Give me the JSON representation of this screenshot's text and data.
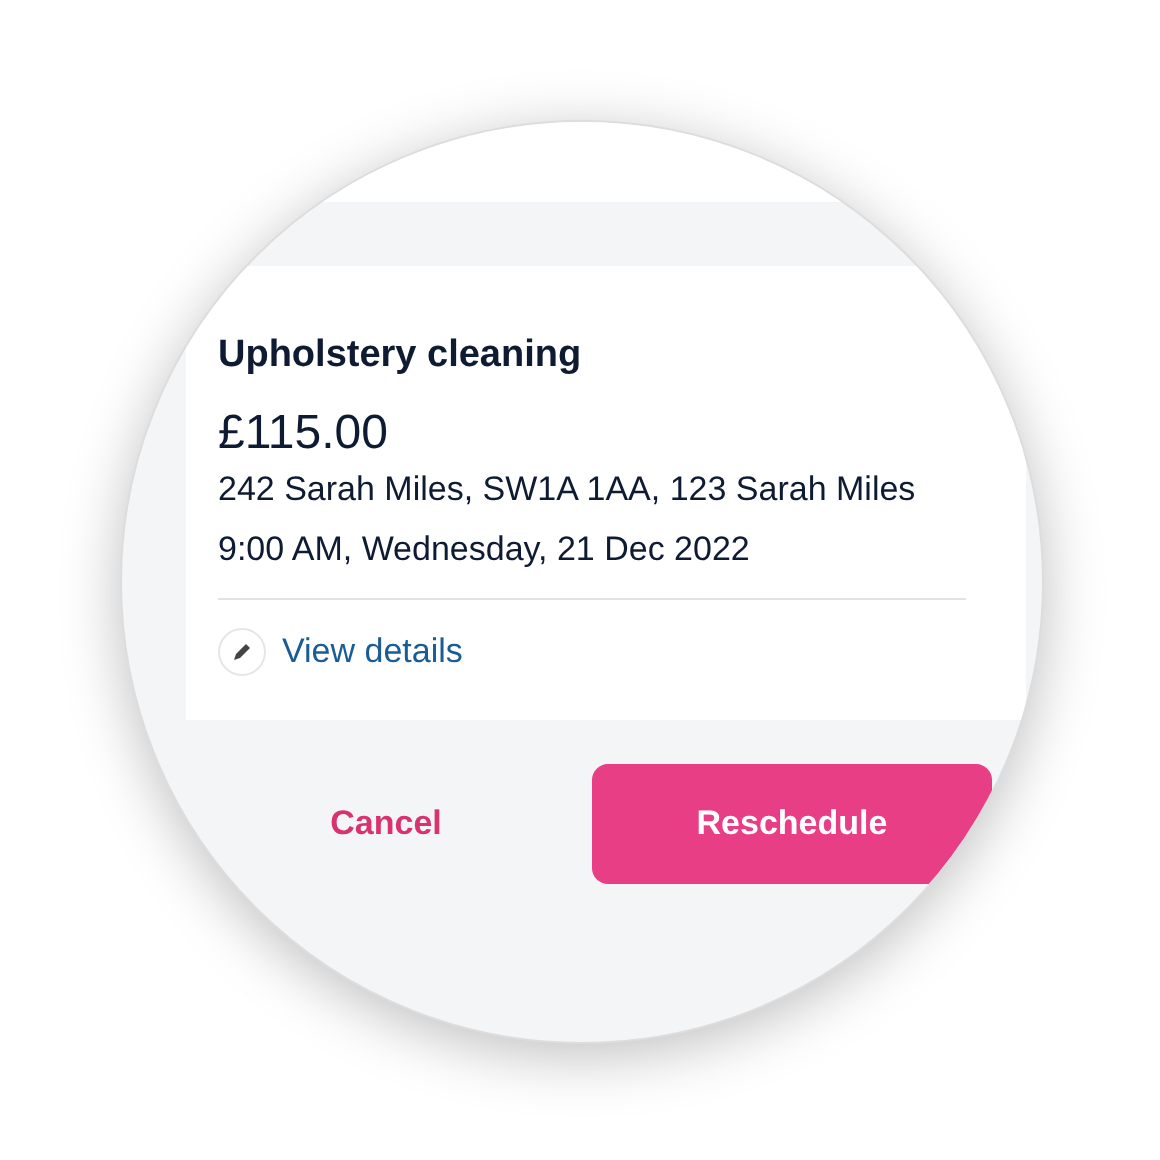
{
  "booking": {
    "service": "Upholstery cleaning",
    "price": "£115.00",
    "address": "242 Sarah Miles, SW1A 1AA, 123 Sarah Miles",
    "time": "9:00 AM, Wednesday, 21 Dec 2022",
    "link": "View details"
  },
  "actions": [
    {
      "label": "Cancel",
      "kind": "text"
    },
    {
      "label": "Reschedule",
      "kind": "primary"
    }
  ]
}
